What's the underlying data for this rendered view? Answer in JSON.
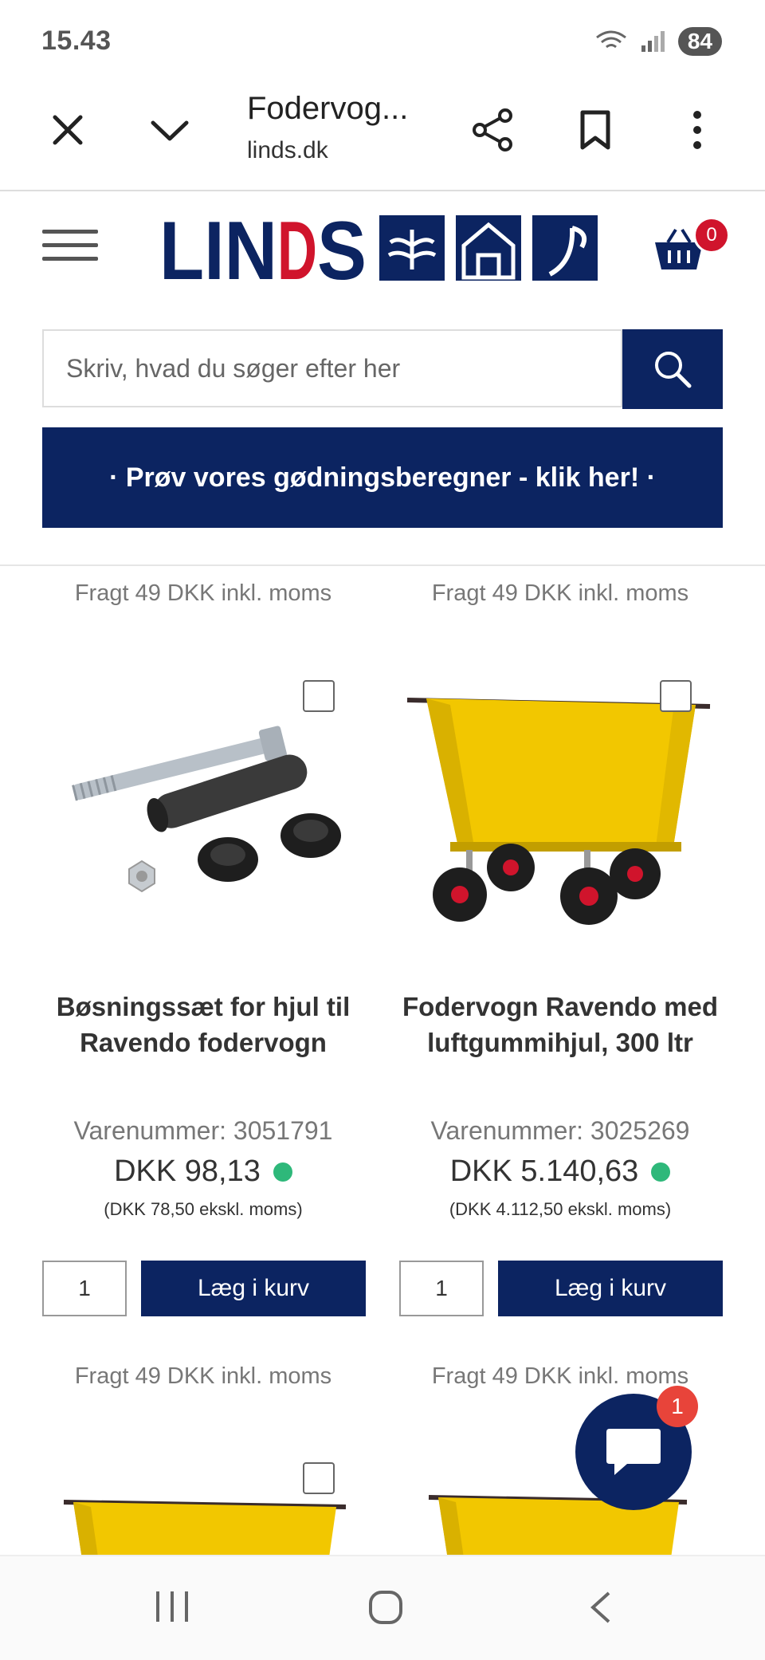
{
  "status_bar": {
    "time": "15.43",
    "battery": "84",
    "network": "5"
  },
  "browser": {
    "title": "Fodervog...",
    "url": "linds.dk"
  },
  "site": {
    "logo_text": "LINDS",
    "cart_count": "0",
    "search_placeholder": "Skriv, hvad du søger efter her",
    "banner": "· Prøv vores gødningsberegner - klik her! ·"
  },
  "top_fragt": [
    "Fragt 49 DKK inkl. moms",
    "Fragt 49 DKK inkl. moms"
  ],
  "products": [
    {
      "title": "Bøsningssæt for hjul til Ravendo fodervogn",
      "varenummer": "Varenummer: 3051791",
      "price": "DKK 98,13",
      "excl": "(DKK 78,50 ekskl. moms)",
      "qty": "1",
      "add_label": "Læg i kurv",
      "fragt": "Fragt 49 DKK inkl. moms",
      "stock_color": "#2eb87a"
    },
    {
      "title": "Fodervogn Ravendo med luftgummihjul, 300 ltr",
      "varenummer": "Varenummer: 3025269",
      "price": "DKK 5.140,63",
      "excl": "(DKK 4.112,50 ekskl. moms)",
      "qty": "1",
      "add_label": "Læg i kurv",
      "fragt": "Fragt 49 DKK inkl. moms",
      "stock_color": "#2eb87a"
    }
  ],
  "chat": {
    "badge": "1"
  },
  "colors": {
    "brand_navy": "#0c2461",
    "brand_red": "#d0142c",
    "cart_yellow": "#f2c700"
  }
}
